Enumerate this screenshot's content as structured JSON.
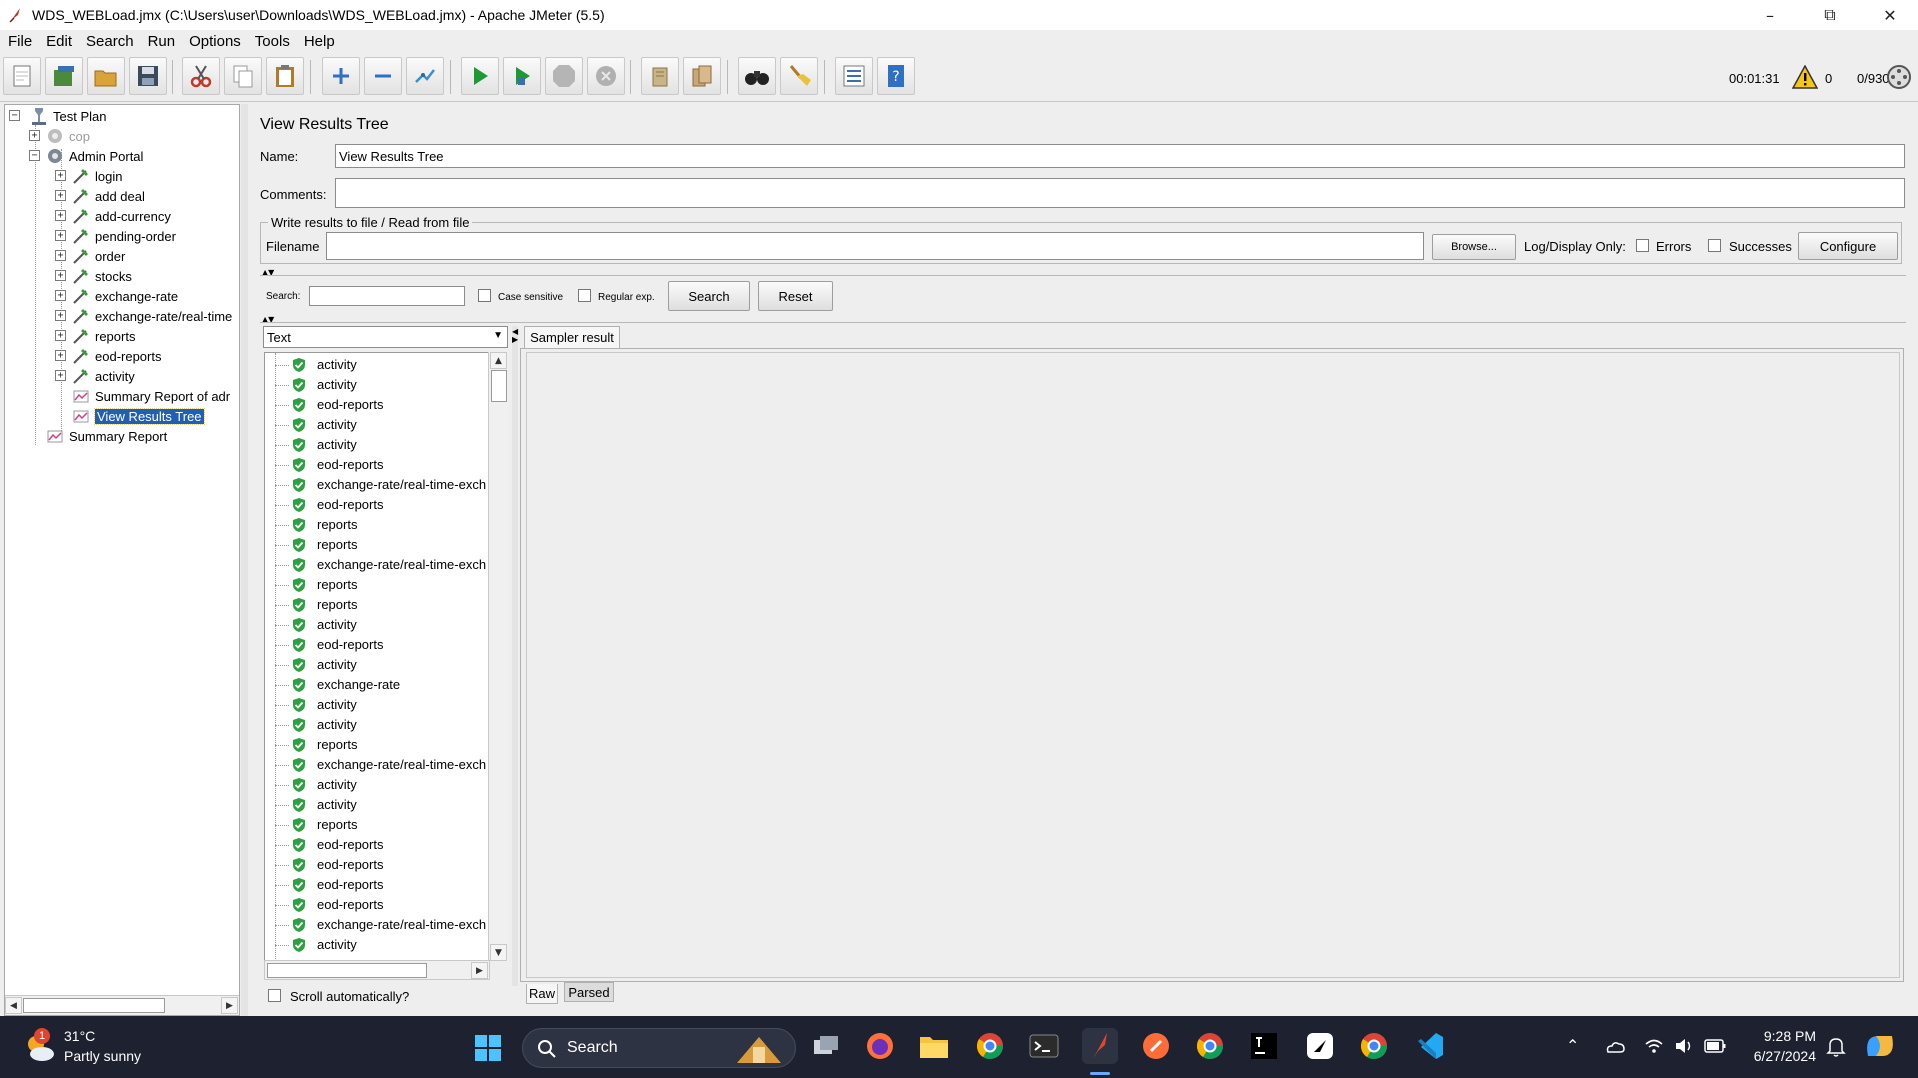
{
  "window": {
    "title": "WDS_WEBLoad.jmx (C:\\Users\\user\\Downloads\\WDS_WEBLoad.jmx) - Apache JMeter (5.5)",
    "minimize": "–",
    "restore": "⧉",
    "close": "✕"
  },
  "menu": [
    "File",
    "Edit",
    "Search",
    "Run",
    "Options",
    "Tools",
    "Help"
  ],
  "toolbar": {
    "icons": [
      "new-icon",
      "templates-icon",
      "open-icon",
      "save-icon",
      "cut-icon",
      "copy-icon",
      "paste-icon",
      "expand-icon",
      "collapse-icon",
      "toggle-icon",
      "start-icon",
      "start-no-pause-icon",
      "stop-icon",
      "shutdown-icon",
      "clear-icon",
      "clear-all-icon",
      "search-icon",
      "reset-search-icon",
      "function-helper-icon",
      "help-icon"
    ],
    "elapsed": "00:01:31",
    "warnings": "0",
    "threads": "0/930"
  },
  "tree": {
    "root": "Test Plan",
    "items": [
      {
        "label": "cop",
        "disabled": true
      },
      {
        "label": "Admin Portal"
      },
      {
        "label": "login"
      },
      {
        "label": "add deal"
      },
      {
        "label": "add-currency"
      },
      {
        "label": "pending-order"
      },
      {
        "label": "order"
      },
      {
        "label": "stocks"
      },
      {
        "label": "exchange-rate"
      },
      {
        "label": "exchange-rate/real-time"
      },
      {
        "label": "reports"
      },
      {
        "label": "eod-reports"
      },
      {
        "label": "activity"
      },
      {
        "label": "Summary Report of adr"
      },
      {
        "label": "View Results Tree"
      },
      {
        "label": "Summary Report"
      }
    ]
  },
  "panel": {
    "title": "View Results Tree",
    "name_label": "Name:",
    "name_value": "View Results Tree",
    "comments_label": "Comments:",
    "comments_value": "",
    "file_group": "Write results to file / Read from file",
    "filename_label": "Filename",
    "filename_value": "",
    "browse": "Browse...",
    "log_display": "Log/Display Only:",
    "errors": "Errors",
    "successes": "Successes",
    "configure": "Configure",
    "search_label": "Search:",
    "search_value": "",
    "case_sensitive": "Case sensitive",
    "regular_exp": "Regular exp.",
    "search_btn": "Search",
    "reset_btn": "Reset",
    "renderer": "Text",
    "sampler_tab": "Sampler result",
    "raw_tab": "Raw",
    "parsed_tab": "Parsed",
    "scroll_auto": "Scroll automatically?"
  },
  "results": [
    "activity",
    "activity",
    "eod-reports",
    "activity",
    "activity",
    "eod-reports",
    "exchange-rate/real-time-exch",
    "eod-reports",
    "reports",
    "reports",
    "exchange-rate/real-time-exch",
    "reports",
    "reports",
    "activity",
    "eod-reports",
    "activity",
    "exchange-rate",
    "activity",
    "activity",
    "reports",
    "exchange-rate/real-time-exch",
    "activity",
    "activity",
    "reports",
    "eod-reports",
    "eod-reports",
    "eod-reports",
    "eod-reports",
    "exchange-rate/real-time-exch",
    "activity"
  ],
  "taskbar": {
    "weather_temp": "31°C",
    "weather_desc": "Partly sunny",
    "weather_badge": "1",
    "search": "Search",
    "time": "9:28 PM",
    "date": "6/27/2024"
  },
  "colors": {
    "success": "#2ea043",
    "selection": "#1f5fb4",
    "taskbar": "#1e2230"
  }
}
